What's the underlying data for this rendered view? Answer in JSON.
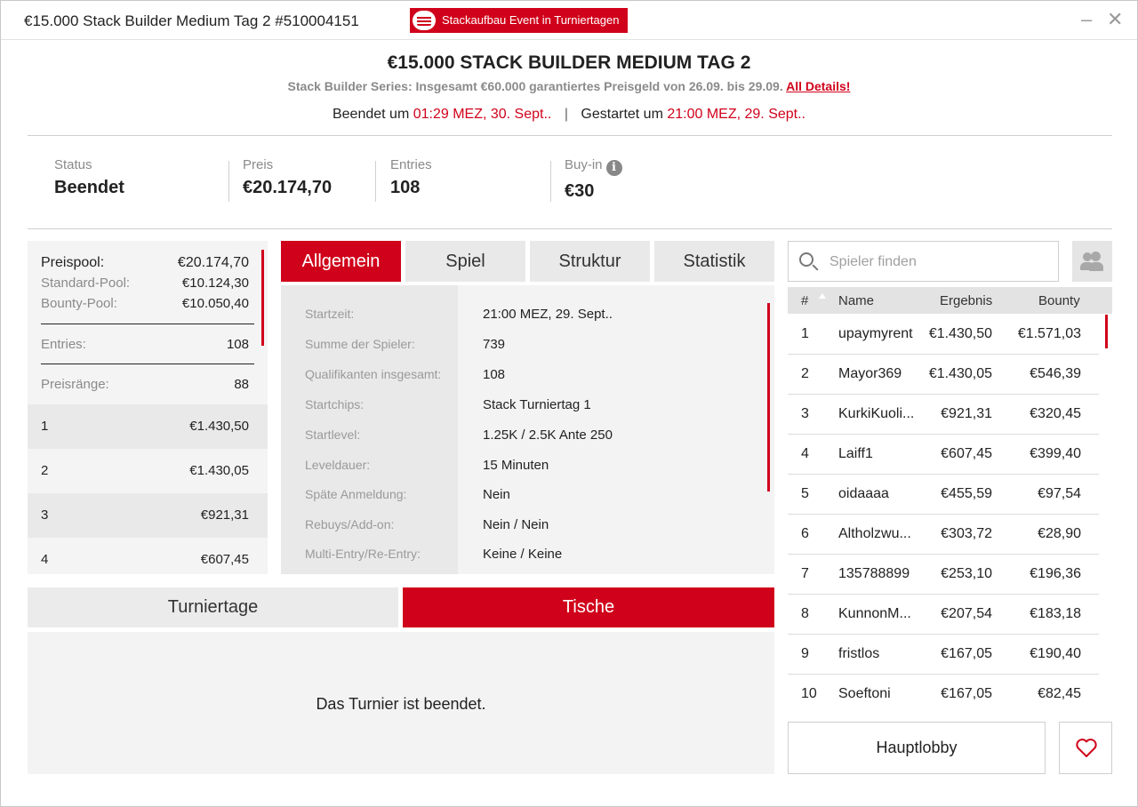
{
  "window": {
    "title": "€15.000 Stack Builder Medium Tag 2 #510004151",
    "event_badge": "Stackaufbau Event in Turniertagen",
    "minimize_icon": "–",
    "close_icon": "✕"
  },
  "header": {
    "title": "€15.000 STACK BUILDER MEDIUM TAG 2",
    "subtitle": "Stack Builder Series: Insgesamt €60.000 garantiertes Preisgeld von 26.09. bis 29.09.",
    "details_link": "All Details!",
    "ended_label": "Beendet um",
    "ended_time": "01:29 MEZ, 30. Sept..",
    "separator": "|",
    "started_label": "Gestartet um",
    "started_time": "21:00 MEZ, 29. Sept.."
  },
  "stats": [
    {
      "label": "Status",
      "value": "Beendet"
    },
    {
      "label": "Preis",
      "value": "€20.174,70"
    },
    {
      "label": "Entries",
      "value": "108"
    },
    {
      "label": "Buy-in",
      "value": "€30"
    }
  ],
  "info_icon": "i",
  "prize": {
    "pool_label": "Preispool:",
    "pool_value": "€20.174,70",
    "standard_label": "Standard-Pool:",
    "standard_value": "€10.124,30",
    "bounty_label": "Bounty-Pool:",
    "bounty_value": "€10.050,40",
    "entries_label": "Entries:",
    "entries_value": "108",
    "ranks_label": "Preisränge:",
    "ranks_value": "88",
    "payouts": [
      {
        "rank": "1",
        "amount": "€1.430,50"
      },
      {
        "rank": "2",
        "amount": "€1.430,05"
      },
      {
        "rank": "3",
        "amount": "€921,31"
      },
      {
        "rank": "4",
        "amount": "€607,45"
      }
    ]
  },
  "tabs": [
    "Allgemein",
    "Spiel",
    "Struktur",
    "Statistik"
  ],
  "info": [
    {
      "key": "Startzeit:",
      "value": "21:00 MEZ, 29. Sept.."
    },
    {
      "key": "Summe der Spieler:",
      "value": "739"
    },
    {
      "key": "Qualifikanten insgesamt:",
      "value": "108"
    },
    {
      "key": "Startchips:",
      "value": "Stack Turniertag 1"
    },
    {
      "key": "Startlevel:",
      "value": "1.25K / 2.5K Ante 250"
    },
    {
      "key": "Leveldauer:",
      "value": "15 Minuten"
    },
    {
      "key": "Späte Anmeldung:",
      "value": "Nein"
    },
    {
      "key": "Rebuys/Add-on:",
      "value": "Nein / Nein"
    },
    {
      "key": "Multi-Entry/Re-Entry:",
      "value": "Keine / Keine"
    }
  ],
  "bottom_tabs": {
    "days": "Turniertage",
    "tables": "Tische",
    "ended_message": "Das Turnier ist beendet."
  },
  "players": {
    "search_placeholder": "Spieler finden",
    "headers": {
      "rank": "#",
      "name": "Name",
      "result": "Ergebnis",
      "bounty": "Bounty"
    },
    "rows": [
      {
        "rank": "1",
        "name": "upaymyrent",
        "result": "€1.430,50",
        "bounty": "€1.571,03"
      },
      {
        "rank": "2",
        "name": "Mayor369",
        "result": "€1.430,05",
        "bounty": "€546,39"
      },
      {
        "rank": "3",
        "name": "KurkiKuoli...",
        "result": "€921,31",
        "bounty": "€320,45"
      },
      {
        "rank": "4",
        "name": "Laiff1",
        "result": "€607,45",
        "bounty": "€399,40"
      },
      {
        "rank": "5",
        "name": "oidaaaa",
        "result": "€455,59",
        "bounty": "€97,54"
      },
      {
        "rank": "6",
        "name": "Altholzwu...",
        "result": "€303,72",
        "bounty": "€28,90"
      },
      {
        "rank": "7",
        "name": "135788899",
        "result": "€253,10",
        "bounty": "€196,36"
      },
      {
        "rank": "8",
        "name": "KunnonM...",
        "result": "€207,54",
        "bounty": "€183,18"
      },
      {
        "rank": "9",
        "name": "fristlos",
        "result": "€167,05",
        "bounty": "€190,40"
      },
      {
        "rank": "10",
        "name": "Soeftoni",
        "result": "€167,05",
        "bounty": "€82,45"
      }
    ],
    "lobby_button": "Hauptlobby"
  },
  "colors": {
    "accent": "#d0021b",
    "panel": "#f3f3f3",
    "panel_dark": "#e9e9e9"
  }
}
